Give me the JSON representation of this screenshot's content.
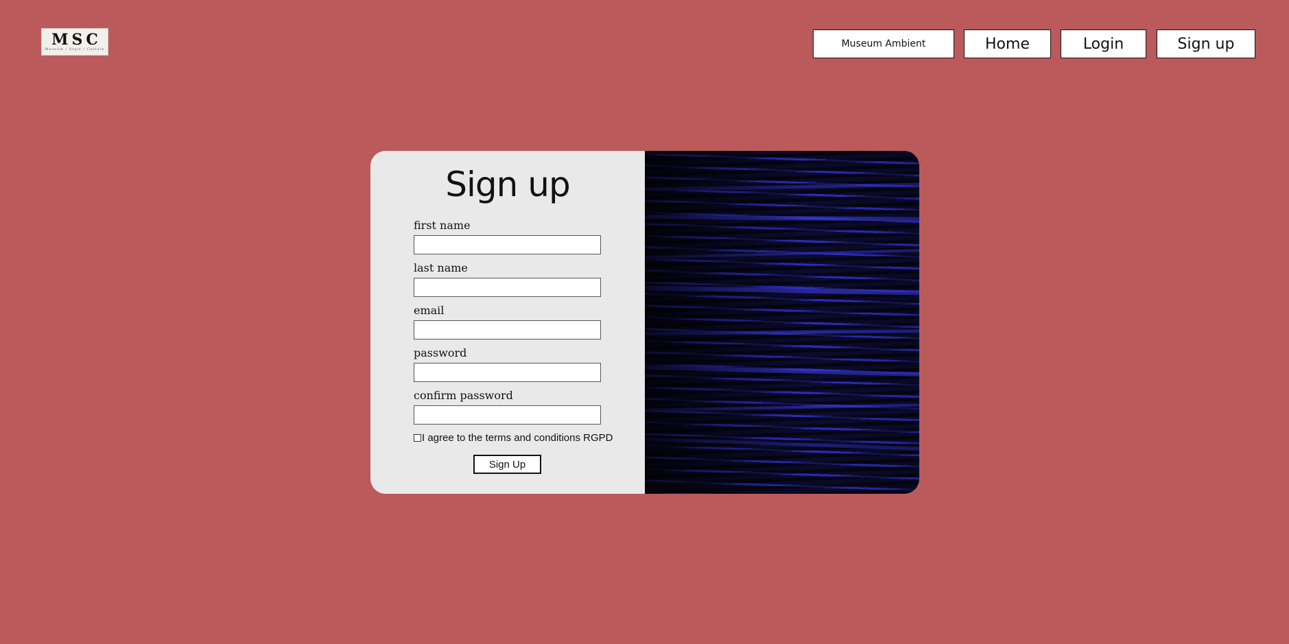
{
  "header": {
    "logo_text": "MSC",
    "logo_subtitle": "Museum / Style / Culture",
    "nav": {
      "museum_ambient": "Museum Ambient",
      "home": "Home",
      "login": "Login",
      "signup": "Sign up"
    }
  },
  "form": {
    "title": "Sign up",
    "fields": {
      "first_name": {
        "label": "first name",
        "value": ""
      },
      "last_name": {
        "label": "last name",
        "value": ""
      },
      "email": {
        "label": "email",
        "value": ""
      },
      "password": {
        "label": "password",
        "value": ""
      },
      "confirm_password": {
        "label": "confirm password",
        "value": ""
      }
    },
    "terms_label": "I agree to the terms and conditions RGPD",
    "terms_checked": false,
    "submit_label": "Sign Up"
  },
  "colors": {
    "background": "#bb5a5a",
    "form_panel": "#e9e9e9",
    "art_blue": "#2d2dd2"
  }
}
